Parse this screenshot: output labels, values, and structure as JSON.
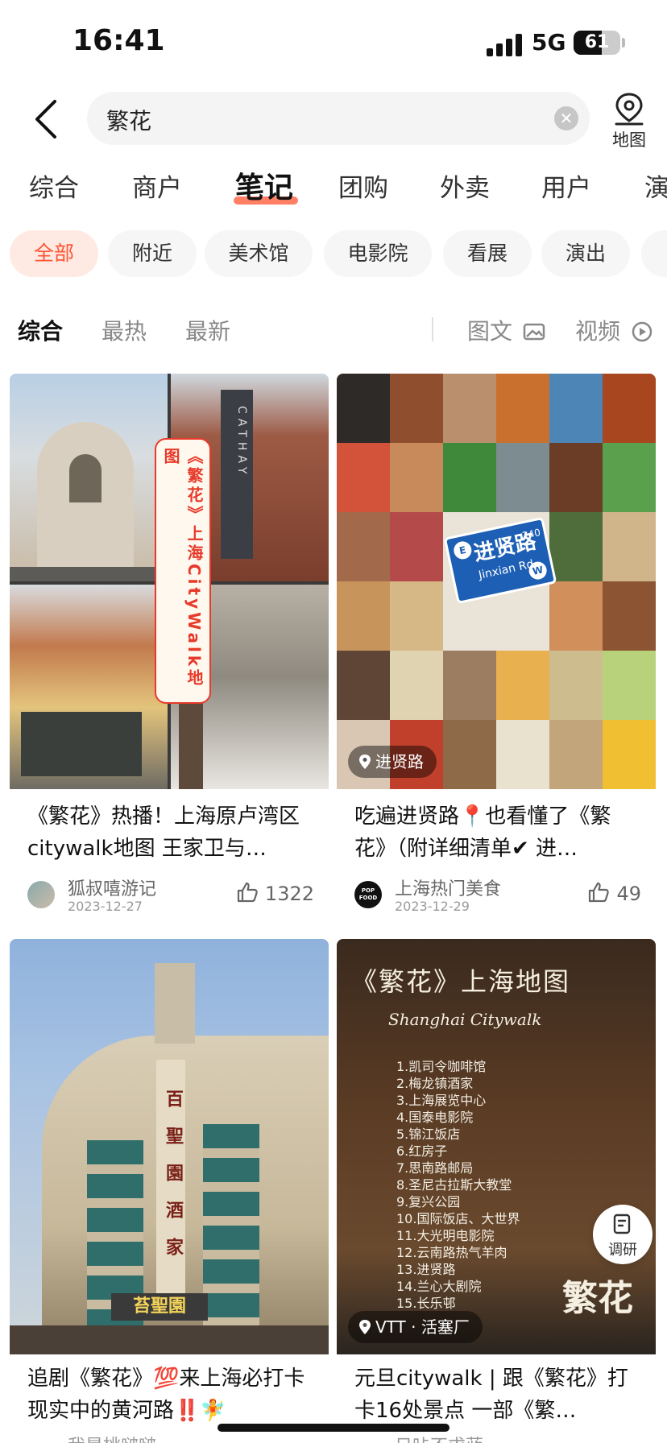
{
  "status": {
    "time": "16:41",
    "network": "5G",
    "battery": "61",
    "battery_level": 0.61
  },
  "search": {
    "query": "繁花",
    "map_label": "地图"
  },
  "main_tabs": [
    "综合",
    "商户",
    "笔记",
    "团购",
    "外卖",
    "用户",
    "演"
  ],
  "active_main_tab": "笔记",
  "chips": [
    "全部",
    "附近",
    "美术馆",
    "电影院",
    "看展",
    "演出",
    "展"
  ],
  "active_chip": "全部",
  "sort": {
    "items": [
      "综合",
      "最热",
      "最新"
    ],
    "active": "综合",
    "image_text": "图文",
    "video": "视频"
  },
  "cards": [
    {
      "title": "《繁花》热播！上海原卢湾区citywalk地图 王家卫与…",
      "author": "狐叔嘻游记",
      "date": "2023-12-27",
      "likes": "1322",
      "overlay": "《繁花》上海CityWalk地图",
      "sign": "CATHAY"
    },
    {
      "title": "吃遍进贤路📍也看懂了《繁花》（附详细清单✔ 进…",
      "author": "上海热门美食",
      "date": "2023-12-29",
      "likes": "49",
      "location": "进贤路",
      "avatar_text": "POP FOOD",
      "sign_cn": "进贤路",
      "sign_en": "Jinxian Rd.",
      "sign_num": "240",
      "sign_e": "E",
      "sign_w": "W"
    },
    {
      "title": "追剧《繁花》💯来上海必打卡现实中的黄河路‼️🧚",
      "author": "我是桃啵啵",
      "sign_vertical": "百聖園酒家",
      "sign_main": "苔聖園"
    },
    {
      "title": "元旦citywalk | 跟《繁花》打卡16处景点 一部《繁…",
      "author": "日咔不求蓝",
      "location": "VTT · 活塞厂",
      "poster_title": "《繁花》上海地图",
      "poster_sub": "Shanghai Citywalk",
      "poster_list": [
        "1.凯司令咖啡馆",
        "2.梅龙镇酒家",
        "3.上海展览中心",
        "4.国泰电影院",
        "5.锦江饭店",
        "6.红房子",
        "7.思南路邮局",
        "8.圣尼古拉斯大教堂",
        "9.复兴公园",
        "10.国际饭店、大世界",
        "11.大光明电影院",
        "12.云南路热气羊肉",
        "13.进贤路",
        "14.兰心大剧院",
        "15.长乐邨"
      ],
      "poster_brand": "繁花",
      "float_label": "调研"
    }
  ]
}
